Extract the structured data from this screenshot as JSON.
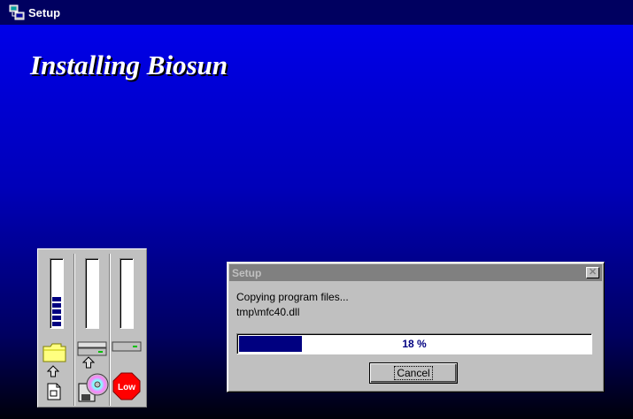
{
  "window": {
    "title": "Setup",
    "icon": "setup-computer-icon"
  },
  "banner": {
    "heading": "Installing Biosun"
  },
  "disk_meters": {
    "gauges": [
      {
        "name": "source",
        "level": 0.45
      },
      {
        "name": "temp",
        "level": 0
      },
      {
        "name": "destination",
        "level": 0
      }
    ],
    "icons": [
      "folder-icon",
      "hard-drive-icon",
      "hard-drive-icon",
      "up-arrow-icon",
      "document-icon",
      "disk-cd-icon",
      "low-stop-sign-icon"
    ],
    "low_sign_label": "Low",
    "colors": {
      "gauge_fill": "#000080",
      "low_sign": "#ff0000",
      "folder": "#ffff80"
    }
  },
  "dialog": {
    "title": "Setup",
    "close_glyph": "✕",
    "status_line": "Copying program files...",
    "file_line": "tmp\\mfc40.dll",
    "progress": {
      "percent": 18,
      "label": "18 %"
    },
    "cancel_label": "Cancel"
  },
  "colors": {
    "desktop_gradient_top": "#0000f0",
    "desktop_gradient_bottom": "#00000a",
    "progress_fill": "#000080",
    "dialog_face": "#c0c0c0"
  }
}
